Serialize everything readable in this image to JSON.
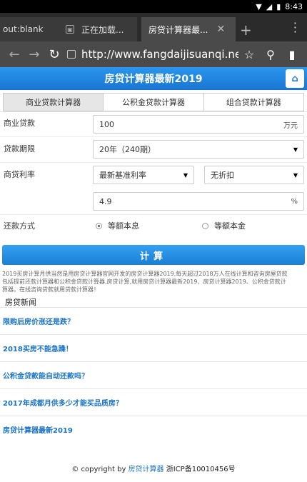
{
  "status": {
    "time": "8:43"
  },
  "browser": {
    "tabs": [
      {
        "title": "out:blank"
      },
      {
        "title": "正在加载..."
      },
      {
        "title": "房贷计算器最..."
      }
    ],
    "new_tab": "+",
    "url": "http://www.fangdaijisuanqi.ne"
  },
  "header": {
    "title": "房贷计算器最新2019"
  },
  "calc_tabs": [
    "商业贷款计算器",
    "公积金贷款计算器",
    "组合贷款计算器"
  ],
  "form": {
    "loan_label": "商业贷款",
    "loan_amount": "100",
    "loan_unit": "万元",
    "term_label": "贷款期限",
    "term_value": "20年（240期）",
    "rate_label": "商贷利率",
    "rate_type": "最新基准利率",
    "discount": "无折扣",
    "rate_value": "4.9",
    "rate_unit": "%",
    "repay_label": "还款方式",
    "repay_options": [
      "等额本息",
      "等额本金"
    ]
  },
  "calc_button": "计算",
  "description": [
    "2019买房计算月供当然是用房贷计算器官网开发的房贷计算器2019,每天超过2018万人在线计算和咨询房屋贷款",
    "包括提前还款计算器和公积金贷款计算器,房贷计算,就用房贷计算器最新2019、房贷计算器2019、公积金贷款计",
    "算器。在线咨询贷款就用贷款计算器！"
  ],
  "news": {
    "title": "房贷新闻",
    "items": [
      "限购后房价涨还是跌？",
      "2018买房不能急躁！",
      "公积金贷款能自动还款吗？",
      "2017年成都月供多少才能买品质房？",
      "房贷计算器最新2019"
    ]
  },
  "footer": {
    "prefix": "© copyright by",
    "link": "房贷计算器",
    "icp": "浙ICP备10010456号"
  }
}
